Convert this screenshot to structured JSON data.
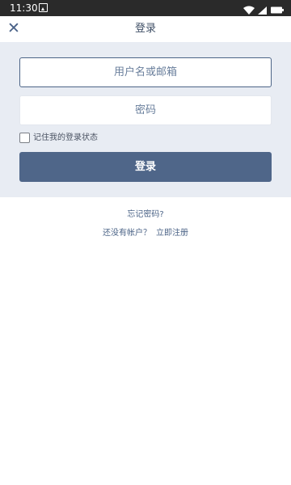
{
  "status_bar": {
    "time": "11:30"
  },
  "app_bar": {
    "title": "登录"
  },
  "form": {
    "username_placeholder": "用户名或邮箱",
    "password_placeholder": "密码",
    "remember_label": "记住我的登录状态",
    "remember_checked": false,
    "login_button": "登录"
  },
  "links": {
    "forgot_password": "忘记密码?",
    "no_account": "还没有帐户？",
    "register": "立即注册"
  },
  "colors": {
    "accent": "#4f6689",
    "panel_background": "#e8ecf3",
    "status_bar": "#2a2a2a"
  },
  "icons": {
    "close": "close-icon",
    "app_notification": "app-notification-icon",
    "wifi": "wifi-icon",
    "signal": "signal-icon",
    "battery": "battery-icon"
  }
}
